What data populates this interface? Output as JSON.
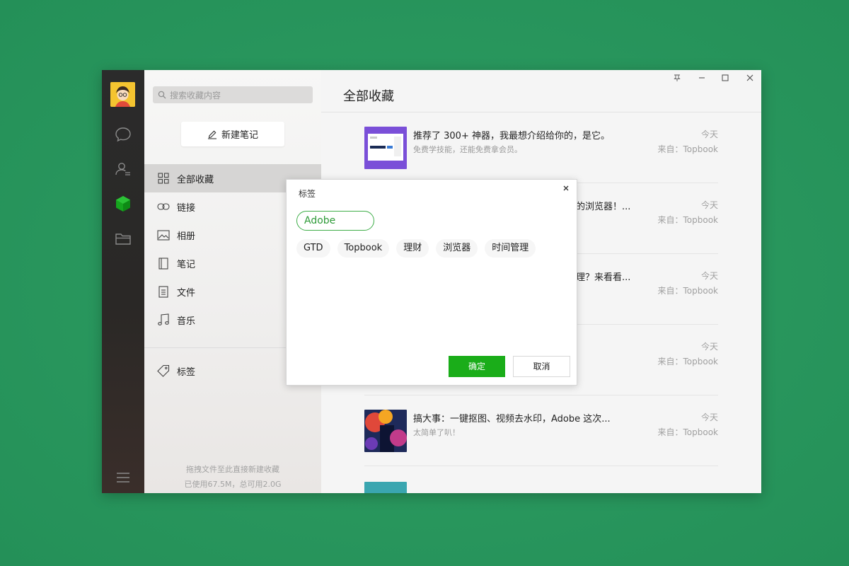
{
  "search": {
    "placeholder": "搜索收藏内容"
  },
  "new_note": {
    "label": "新建笔记"
  },
  "nav": {
    "items": [
      {
        "label": "全部收藏",
        "icon": "grid-icon"
      },
      {
        "label": "链接",
        "icon": "link-icon"
      },
      {
        "label": "相册",
        "icon": "image-icon"
      },
      {
        "label": "笔记",
        "icon": "notebook-icon"
      },
      {
        "label": "文件",
        "icon": "file-icon"
      },
      {
        "label": "音乐",
        "icon": "music-icon"
      }
    ],
    "tags_label": "标签",
    "storage_line1": "拖拽文件至此直接新建收藏",
    "storage_line2": "已使用67.5M，总可用2.0G"
  },
  "content": {
    "title": "全部收藏",
    "items": [
      {
        "title": "推荐了 300+ 神器，我最想介绍给你的，是它。",
        "subtitle": "免费学技能，还能免费拿会员。",
        "date": "今天",
        "source": "来自：Topbook"
      },
      {
        "title": "的浏览器！...",
        "subtitle": "",
        "date": "今天",
        "source": "来自：Topbook"
      },
      {
        "title": "理？来看看...",
        "subtitle": "",
        "date": "今天",
        "source": "来自：Topbook"
      },
      {
        "title": "",
        "subtitle": "",
        "date": "今天",
        "source": "来自：Topbook"
      },
      {
        "title": "搞大事：一键抠图、视频去水印，Adobe 这次...",
        "subtitle": "太简单了叭！",
        "date": "今天",
        "source": "来自：Topbook"
      }
    ]
  },
  "dialog": {
    "title": "标签",
    "input_value": "Adobe",
    "tags": [
      "GTD",
      "Topbook",
      "理财",
      "浏览器",
      "时间管理"
    ],
    "ok_label": "确定",
    "cancel_label": "取消"
  },
  "colors": {
    "accent": "#1aad19",
    "rail": "#2b2b2b",
    "page_bg": "#2e9e63"
  }
}
